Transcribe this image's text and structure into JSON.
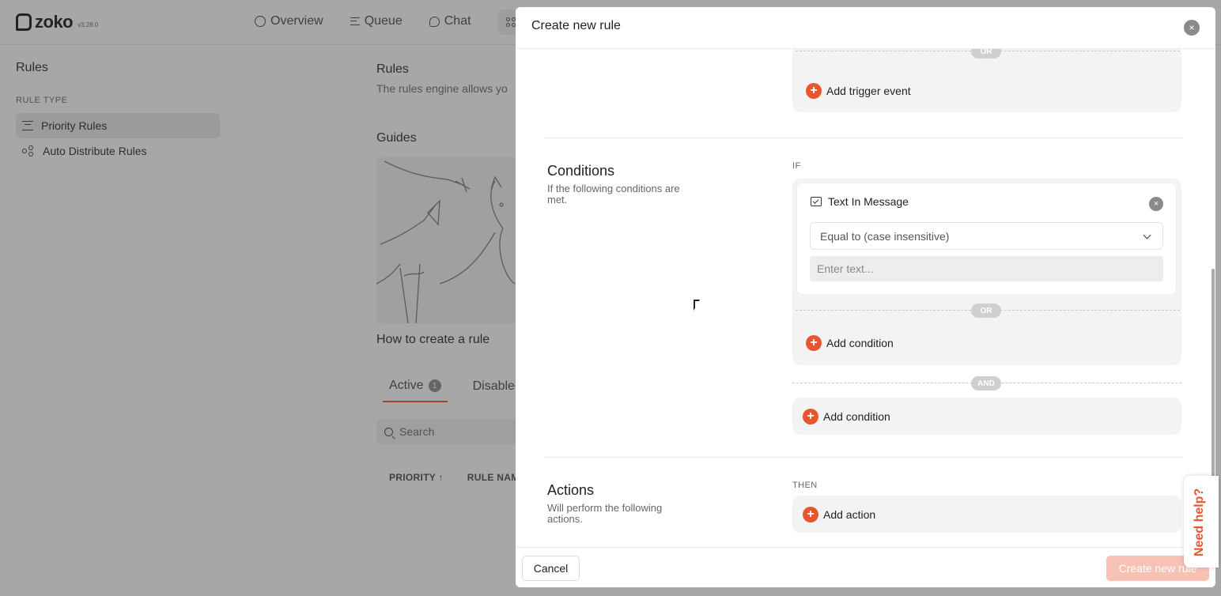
{
  "app": {
    "logo_text": "zoko",
    "version": "v3.28.0",
    "nav": [
      {
        "label": "Overview",
        "icon": "circle-icon"
      },
      {
        "label": "Queue",
        "icon": "queue-icon"
      },
      {
        "label": "Chat",
        "icon": "chat-icon"
      }
    ]
  },
  "sidebar": {
    "title": "Rules",
    "section_label": "RULE TYPE",
    "items": [
      {
        "label": "Priority Rules",
        "icon": "priority-rules-icon",
        "active": true
      },
      {
        "label": "Auto Distribute Rules",
        "icon": "auto-distribute-icon",
        "active": false
      }
    ]
  },
  "content": {
    "title": "Rules",
    "description": "The rules engine allows yo",
    "guides_title": "Guides",
    "guide_caption": "How to create a rule",
    "tabs": [
      {
        "label": "Active",
        "count": "1"
      },
      {
        "label": "Disabled"
      }
    ],
    "search_placeholder": "Search",
    "table_headers": [
      "PRIORITY ↑",
      "RULE NAM"
    ]
  },
  "modal": {
    "title": "Create new rule",
    "close": "×",
    "trigger": {
      "or_pill": "OR",
      "add_label": "Add trigger event"
    },
    "conditions": {
      "title": "Conditions",
      "description": "If the following conditions are met.",
      "keyword": "IF",
      "condition": {
        "label": "Text In Message",
        "operator": "Equal to (case insensitive)",
        "placeholder": "Enter text...",
        "value": "",
        "close": "×"
      },
      "or_pill": "OR",
      "add_inner_label": "Add condition",
      "and_pill": "AND",
      "add_outer_label": "Add condition"
    },
    "actions": {
      "title": "Actions",
      "description": "Will perform the following actions.",
      "keyword": "THEN",
      "add_label": "Add action"
    },
    "footer": {
      "cancel": "Cancel",
      "create": "Create new rule"
    }
  },
  "help": {
    "label": "Need help?"
  },
  "colors": {
    "accent": "#e8552f",
    "overlay": "#3c3c3c"
  }
}
